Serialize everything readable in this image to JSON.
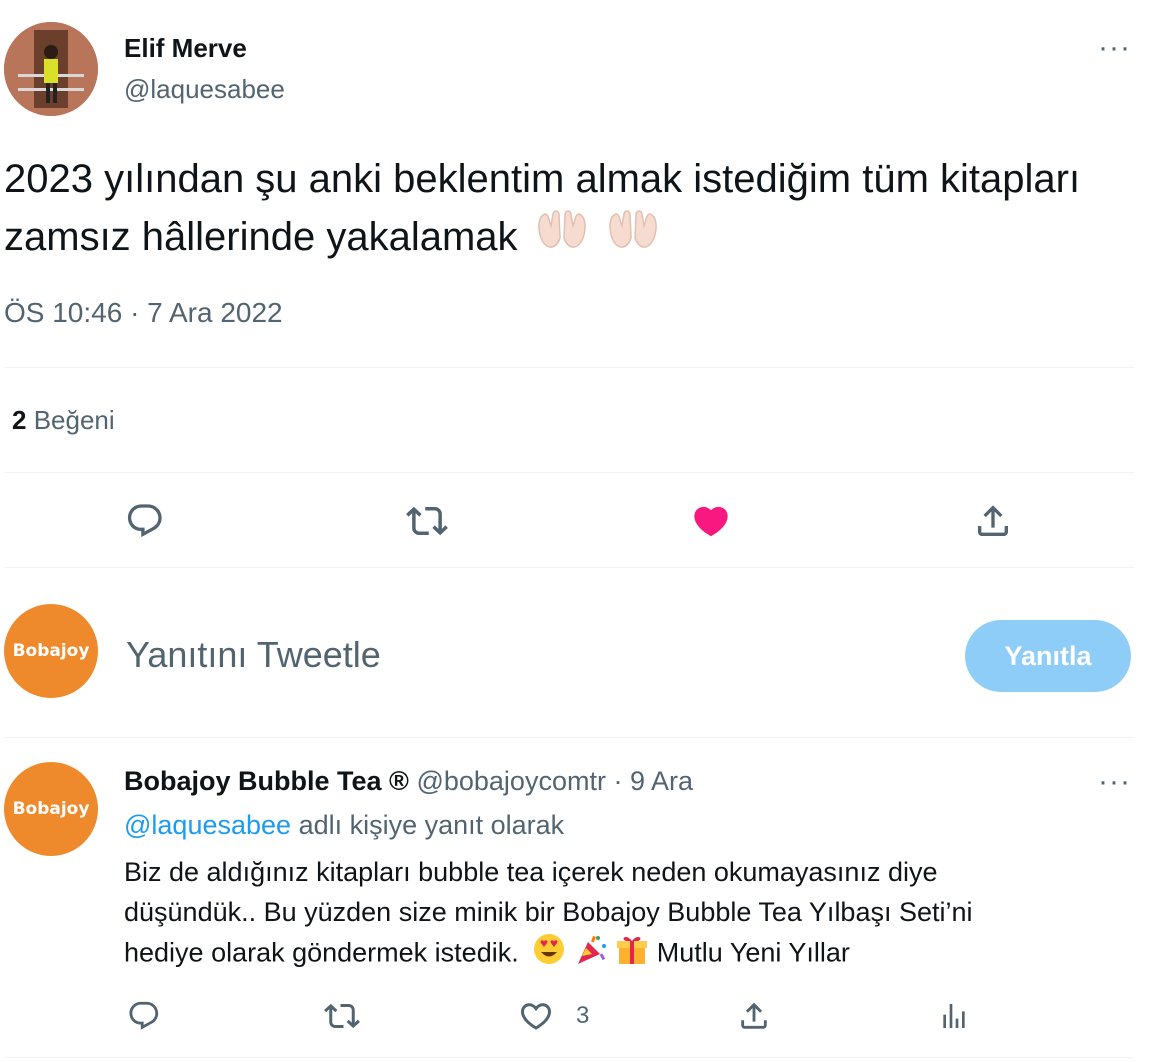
{
  "main_tweet": {
    "author_name": "Elif Merve",
    "author_handle": "@laquesabee",
    "text": "2023 yılından şu anki beklentim almak istediğim tüm kitapları zamsız hâllerinde yakalamak",
    "timestamp": "ÖS 10:46 · 7 Ara 2022",
    "like_count": "2",
    "like_label": "Beğeni",
    "liked": true,
    "more_label": "···"
  },
  "composer": {
    "avatar_text": "Bobajoy",
    "placeholder": "Yanıtını Tweetle",
    "button_label": "Yanıtla"
  },
  "reply_tweet": {
    "avatar_text": "Bobajoy",
    "author_name": "Bobajoy Bubble Tea ®",
    "author_handle": "@bobajoycomtr",
    "date": "· 9 Ara",
    "replying_to_handle": "@laquesabee",
    "replying_to_suffix": "adlı kişiye yanıt olarak",
    "text_line1": "Biz de aldığınız kitapları bubble tea içerek neden okumayasınız diye",
    "text_line2": "düşündük.. Bu yüzden size minik bir Bobajoy Bubble Tea Yılbaşı Seti’ni",
    "text_line3a": "hediye olarak göndermek istedik.",
    "text_line3b": "Mutlu Yeni Yıllar",
    "like_count": "3",
    "more_label": "···"
  },
  "colors": {
    "accent": "#1d9bf0",
    "like_pink": "#f91880",
    "reply_button_disabled": "#8ecdf8",
    "brand_orange": "#ef8a2c",
    "muted_text": "#536471"
  },
  "icons": [
    "reply-icon",
    "retweet-icon",
    "heart-icon",
    "share-icon",
    "analytics-icon",
    "more-icon",
    "raised-hands-emoji",
    "heart-eyes-emoji",
    "party-popper-emoji",
    "gift-emoji"
  ]
}
